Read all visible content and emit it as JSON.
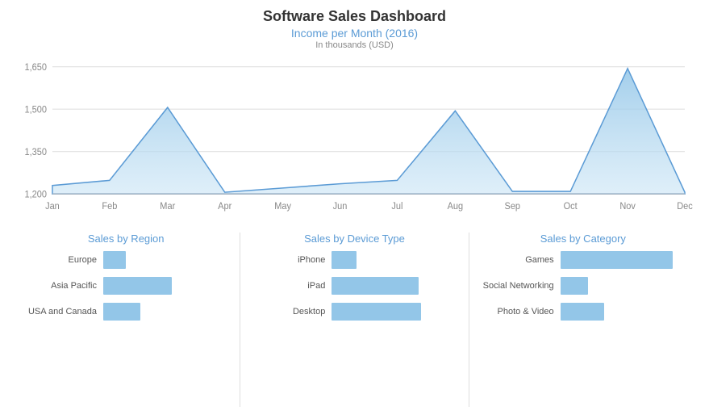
{
  "title": "Software Sales Dashboard",
  "income_chart": {
    "title": "Income per Month (2016)",
    "subtitle": "In thousands (USD)",
    "y_labels": [
      "1,650",
      "1,500",
      "1,350",
      "1,200"
    ],
    "x_labels": [
      "Jan",
      "Feb",
      "Mar",
      "Apr",
      "May",
      "Jun",
      "Jul",
      "Aug",
      "Sep",
      "Oct",
      "Nov",
      "Dec"
    ],
    "accent_color": "#5b9bd5"
  },
  "region_chart": {
    "title": "Sales by Region",
    "bars": [
      {
        "label": "Europe",
        "value": 18
      },
      {
        "label": "Asia Pacific",
        "value": 55
      },
      {
        "label": "USA and Canada",
        "value": 30
      }
    ]
  },
  "device_chart": {
    "title": "Sales by Device Type",
    "bars": [
      {
        "label": "iPhone",
        "value": 20
      },
      {
        "label": "iPad",
        "value": 70
      },
      {
        "label": "Desktop",
        "value": 72
      }
    ]
  },
  "category_chart": {
    "title": "Sales by Category",
    "bars": [
      {
        "label": "Games",
        "value": 90
      },
      {
        "label": "Social Networking",
        "value": 22
      },
      {
        "label": "Photo & Video",
        "value": 35
      }
    ]
  }
}
